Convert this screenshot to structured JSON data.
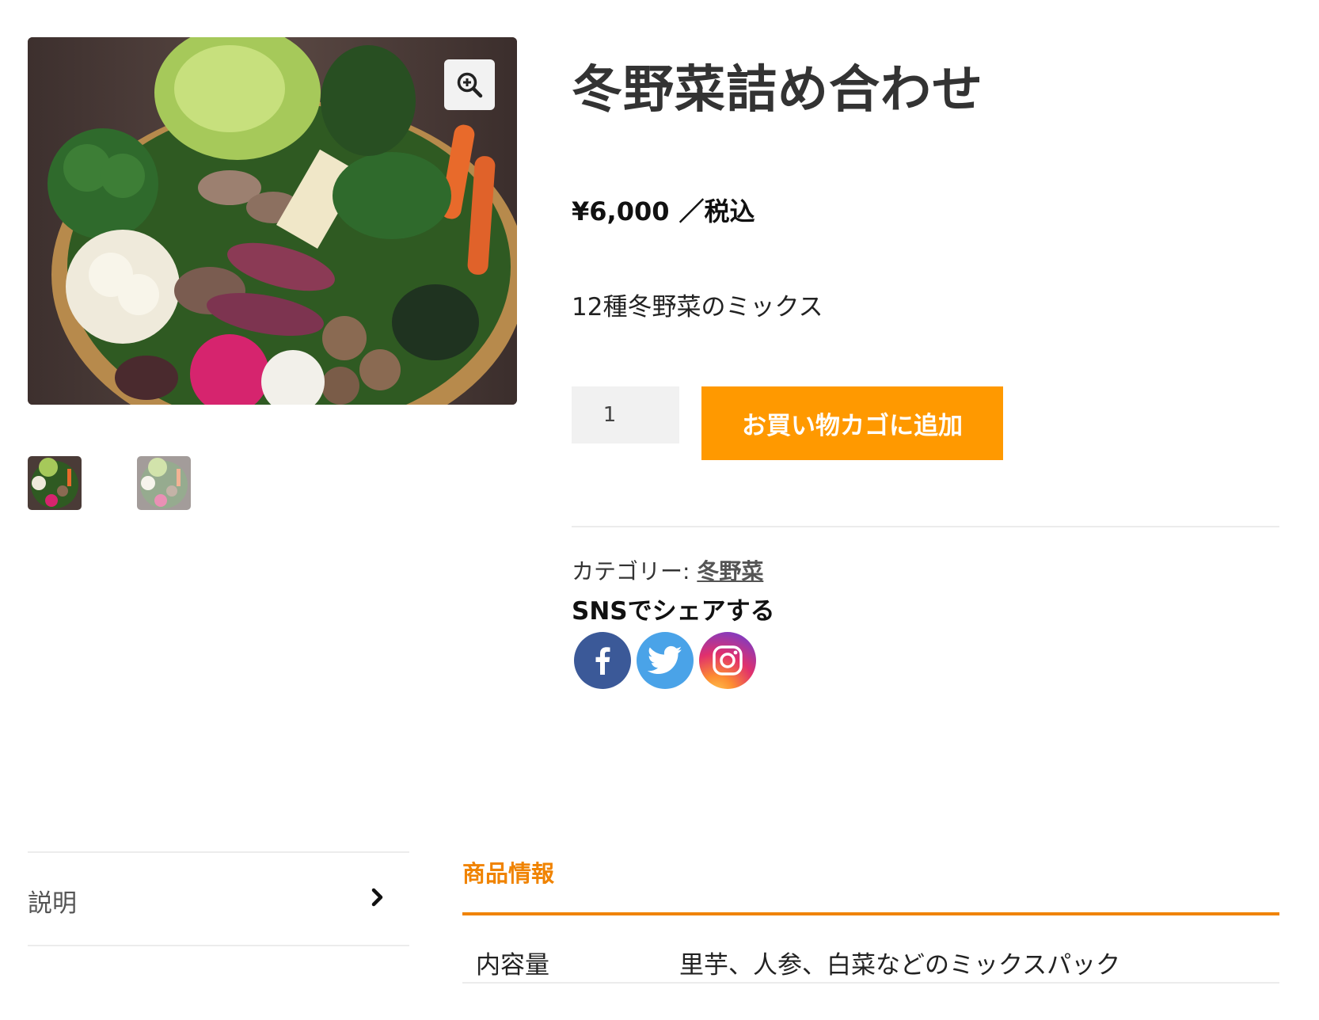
{
  "product": {
    "title": "冬野菜詰め合わせ",
    "price": "¥6,000",
    "price_suffix": "／税込",
    "short_description": "12種冬野菜のミックス",
    "quantity": "1",
    "add_to_cart_label": "お買い物カゴに追加",
    "category_label": "カテゴリー:",
    "category_value": "冬野菜",
    "main_image_subject": "basket of assorted winter vegetables",
    "gallery_thumbnail_count": 2
  },
  "share": {
    "title": "SNSでシェアする",
    "icons": [
      "facebook-icon",
      "twitter-icon",
      "instagram-icon"
    ]
  },
  "tabs": {
    "items": [
      {
        "label": "説明"
      }
    ],
    "panel_heading": "商品情報",
    "specs": [
      {
        "key": "内容量",
        "value": "里芋、人参、白菜などのミックスパック"
      }
    ]
  },
  "colors": {
    "accent": "#ff9900",
    "tab_accent": "#f08300",
    "facebook": "#3b5998",
    "twitter": "#4aa3e8"
  }
}
